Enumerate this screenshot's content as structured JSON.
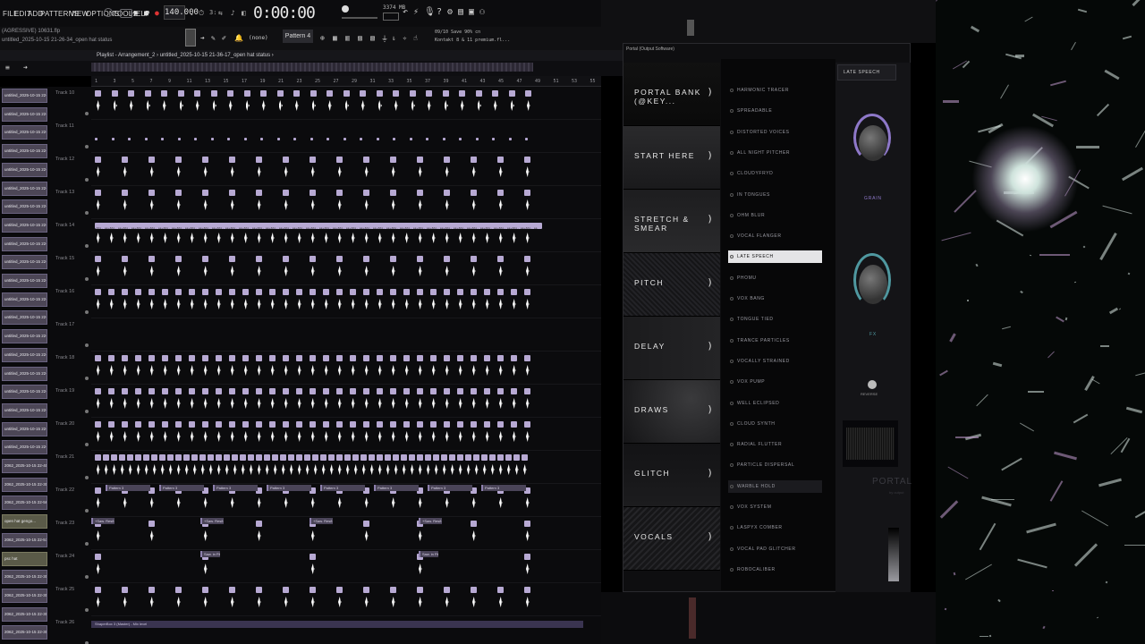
{
  "menu": [
    "FILE",
    "EDIT",
    "ADD",
    "PATTERNS",
    "VIEW",
    "OPTIONS",
    "TOOLS",
    "HELP"
  ],
  "transport": {
    "tempo": "140.000",
    "time": "0:00:00"
  },
  "hint": {
    "line1": "(AGRESSIVE) 10631.flp",
    "line2": "untitled_2025-10-15 21-26-34_open hat status"
  },
  "toolbar": {
    "pattern": "Pattern 4",
    "snap": "(none)"
  },
  "cpu": {
    "value": "3374 MB",
    "line1": "09/10 Save 90% cn",
    "line2": "Kontakt 8 & 11 premium.fl..."
  },
  "breadcrumb": "Playlist - Arrangement_2 › untitled_2025-10-15 21-36-17_open hat status ›",
  "ruler": [
    "1",
    "3",
    "5",
    "7",
    "9",
    "11",
    "13",
    "15",
    "17",
    "19",
    "21",
    "23",
    "25",
    "27",
    "29",
    "31",
    "33",
    "35",
    "37",
    "39",
    "41",
    "43",
    "45",
    "47",
    "49",
    "51",
    "53",
    "55"
  ],
  "clips": [
    "untitled_2025-10-15 22-...",
    "untitled_2025-10-15 22-...",
    "untitled_2025-10-15 22-...",
    "untitled_2025-10-15 22-...",
    "untitled_2025-10-15 22-...",
    "untitled_2025-10-15 22-...",
    "untitled_2025-10-15 22-...",
    "untitled_2025-10-15 22-...",
    "untitled_2025-10-15 22-...",
    "untitled_2025-10-15 22-...",
    "untitled_2025-10-15 22-...",
    "untitled_2025-10-15 22-...",
    "untitled_2025-10-15 22-...",
    "untitled_2025-10-15 22-...",
    "untitled_2025-10-15 22-...",
    "untitled_2025-10-15 22-...",
    "untitled_2025-10-15 22-...",
    "untitled_2025-10-15 22-...",
    "untitled_2025-10-15 22-...",
    "untitled_2025-10-15 22-...",
    "2062_2025-10-15 22-40-...",
    "2062_2025-10-15 22-30-...",
    "2062_2025-10-15 22-56-...",
    "open hat gengo...",
    "2062_2025-10-15 22-57-...",
    "psc hat",
    "2062_2025-10-15 22-30-...",
    "2062_2025-10-15 22-30-...",
    "2062_2025-10-15 22-30-...",
    "2062_2025-10-15 22-30-...",
    "2062_2025-10-15 22-30-..."
  ],
  "tracks": [
    "Track 10",
    "Track 11",
    "Track 12",
    "Track 13",
    "Track 14",
    "Track 15",
    "Track 16",
    "Track 17",
    "Track 18",
    "Track 19",
    "Track 20",
    "Track 21",
    "Track 22",
    "Track 23",
    "Track 24",
    "Track 25",
    "Track 26"
  ],
  "patternClips": {
    "track22": "Pattern 3",
    "track23": "+Saw. Res8",
    "track24": "Saw. in Fill",
    "track14": "+Shi. sa"
  },
  "automation": "ShaperBox 3 (Master) - Mix level",
  "plugin": {
    "title": "Portal (Output Software)",
    "banks": [
      "PORTAL BANK (@KEY...",
      "START HERE",
      "STRETCH & SMEAR",
      "PITCH",
      "DELAY",
      "DRAWS",
      "GLITCH",
      "VOCALS"
    ],
    "presets": [
      "HARMONIC TRACER",
      "SPREADABLE",
      "DISTORTED VOICES",
      "ALL NIGHT PITCHER",
      "CLOUDYFRYD",
      "IN TONGUES",
      "OHM BLUR",
      "VOCAL FLANGER",
      "LATE SPEECH",
      "PHOMU",
      "VOX BANG",
      "TONGUE TIED",
      "TRANCE PARTICLES",
      "VOCALLY STRAINED",
      "VOX PUMP",
      "WELL ECLIPSED",
      "CLOUD SYNTH",
      "RADIAL FLUTTER",
      "PARTICLE DISPERSAL",
      "WARBLE HOLD",
      "VOX SYSTEM",
      "LASPYX COMBER",
      "VOCAL PAD GLITCHER",
      "ROBOCALIBER"
    ],
    "selectedPreset": "LATE SPEECH",
    "hoverPreset": "WARBLE HOLD",
    "header": "LATE SPEECH",
    "knob1": "GRAIN",
    "knob2": "FX",
    "reverse": "REVERSE",
    "logo": "PORTAL",
    "logoSub": "by output"
  },
  "colors": {
    "accent": "#8e78c9",
    "fx": "#4f98a0",
    "clip": "#4c4656",
    "note": "#b7a9d3"
  }
}
